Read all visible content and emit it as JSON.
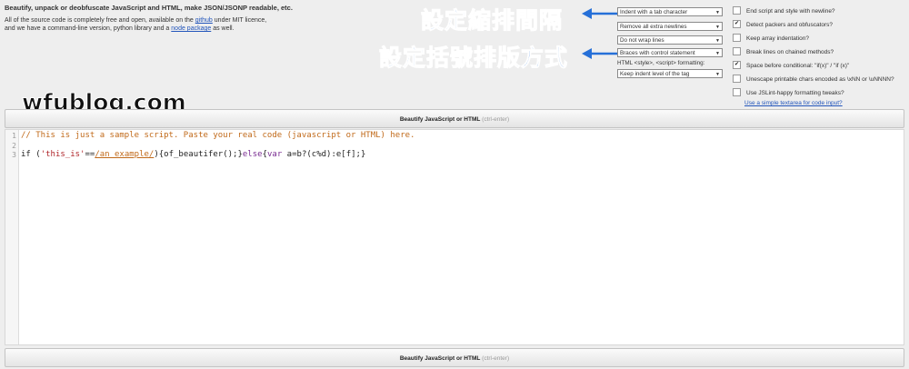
{
  "intro": {
    "title": "Beautify, unpack or deobfuscate JavaScript and HTML, make JSON/JSONP readable, etc.",
    "line1_before": "All of the source code is completely free and open, available on the",
    "line1_link": "github",
    "line1_after": "under MIT licence,",
    "line2_before": "and we have a command-line version, python library and a",
    "line2_link": "node package",
    "line2_after": "as well."
  },
  "annotations": {
    "indent": "設定縮排間隔",
    "braces": "設定括號排版方式",
    "color": "#2670d8"
  },
  "selects": {
    "indent": "Indent with a tab character",
    "newlines": "Remove all extra newlines",
    "wrap": "Do not wrap lines",
    "braces": "Braces with control statement",
    "html_label": "HTML <style>, <script> formatting:",
    "html_indent": "Keep indent level of the tag"
  },
  "options": [
    {
      "label": "End script and style with newline?",
      "checked": false
    },
    {
      "label": "Detect packers and obfuscators?",
      "checked": true
    },
    {
      "label": "Keep array indentation?",
      "checked": false
    },
    {
      "label": "Break lines on chained methods?",
      "checked": false
    },
    {
      "label": "Space before conditional: \"if(x)\" / \"if (x)\"",
      "checked": true
    },
    {
      "label": "Unescape printable chars encoded as \\xNN or \\uNNNN?",
      "checked": false
    },
    {
      "label": "Use JSLint-happy formatting tweaks?",
      "checked": false
    }
  ],
  "simple_textarea_link": "Use a simple textarea for code input?",
  "watermark": "wfublog.com",
  "button": {
    "label": "Beautify JavaScript or HTML",
    "hint": "(ctrl-enter)"
  },
  "editor": {
    "line_numbers": [
      "1",
      "2",
      "3"
    ],
    "line1": "// This is just a sample script. Paste your real code (javascript or HTML) here.",
    "line3": {
      "p1": "if (",
      "str": "'this_is'",
      "p2": "==",
      "re": "/an_example/",
      "p3": "){of_beautifer();}",
      "kw_else": "else",
      "p4": "{",
      "kw_var": "var",
      "p5": " a=b?(c%d):e[f];}"
    }
  }
}
